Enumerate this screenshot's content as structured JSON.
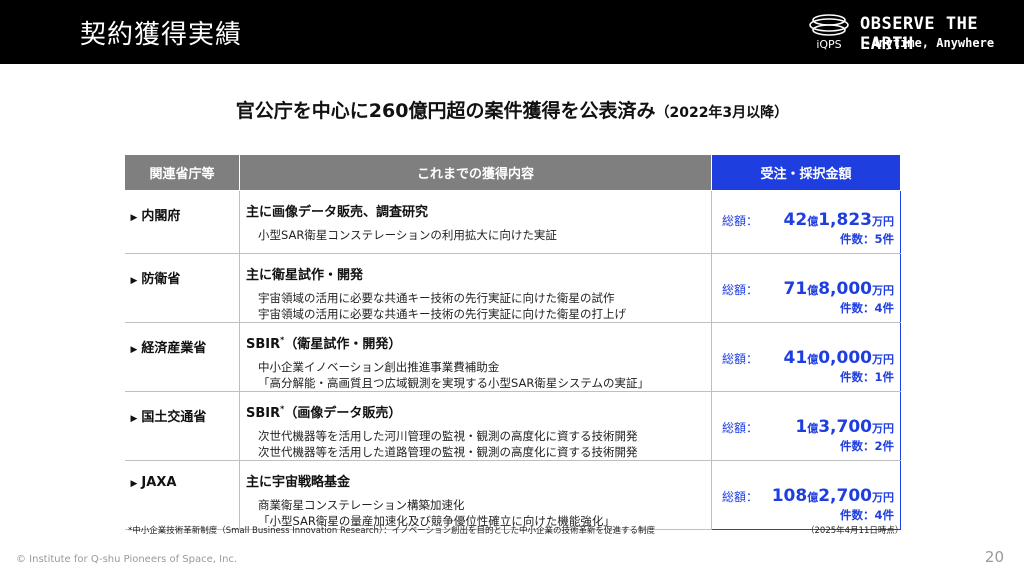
{
  "header": {
    "title": "契約獲得実績",
    "logo_text": "iQPS",
    "brand_line1": "OBSERVE THE EARTH",
    "brand_line2": "-Anytime, Anywhere"
  },
  "subtitle": {
    "main": "官公庁を中心に260億円超の案件獲得を公表済み",
    "sub": "（2022年3月以降）"
  },
  "table": {
    "headers": [
      "関連省庁等",
      "これまでの獲得内容",
      "受注・採択金額"
    ],
    "total_label": "総額：",
    "rows": [
      {
        "agency": "内閣府",
        "main": "主に画像データ販売、調査研究",
        "main_sup": "",
        "main_suffix": "",
        "details": [
          "小型SAR衛星コンステレーションの利用拡大に向けた実証"
        ],
        "amount_oku": "42",
        "amount_man": "1,823",
        "count": "件数：5件"
      },
      {
        "agency": "防衛省",
        "main": "主に衛星試作・開発",
        "main_sup": "",
        "main_suffix": "",
        "details": [
          "宇宙領域の活用に必要な共通キー技術の先行実証に向けた衛星の試作",
          "宇宙領域の活用に必要な共通キー技術の先行実証に向けた衛星の打上げ"
        ],
        "amount_oku": "71",
        "amount_man": "8,000",
        "count": "件数：4件"
      },
      {
        "agency": "経済産業省",
        "main": "SBIR",
        "main_sup": "*",
        "main_suffix": "（衛星試作・開発）",
        "details": [
          "中小企業イノベーション創出推進事業費補助金",
          "「高分解能・高画質且つ広域観測を実現する小型SAR衛星システムの実証」"
        ],
        "amount_oku": "41",
        "amount_man": "0,000",
        "count": "件数：1件"
      },
      {
        "agency": "国土交通省",
        "main": "SBIR",
        "main_sup": "*",
        "main_suffix": "（画像データ販売）",
        "details": [
          "次世代機器等を活用した河川管理の監視・観測の高度化に資する技術開発",
          "次世代機器等を活用した道路管理の監視・観測の高度化に資する技術開発"
        ],
        "amount_oku": "1",
        "amount_man": "3,700",
        "count": "件数：2件"
      },
      {
        "agency": "JAXA",
        "main": "主に宇宙戦略基金",
        "main_sup": "",
        "main_suffix": "",
        "details": [
          "商業衛星コンステレーション構築加速化",
          "「小型SAR衛星の量産加速化及び競争優位性確立に向けた機能強化」"
        ],
        "amount_oku": "108",
        "amount_man": "2,700",
        "count": "件数：4件"
      }
    ],
    "unit_oku": "億",
    "unit_man": "万円"
  },
  "footnote": "*中小企業技術革新制度（Small Business Innovation Research）：イノベーション創出を目的とした中小企業の技術革新を促進する制度",
  "as_of": "（2025年4月11日時点）",
  "copyright": "© Institute for Q-shu Pioneers of Space, Inc.",
  "page_number": "20",
  "colors": {
    "header_bg": "#000000",
    "accent": "#1f3ee0",
    "table_head": "#7f7f7f"
  }
}
